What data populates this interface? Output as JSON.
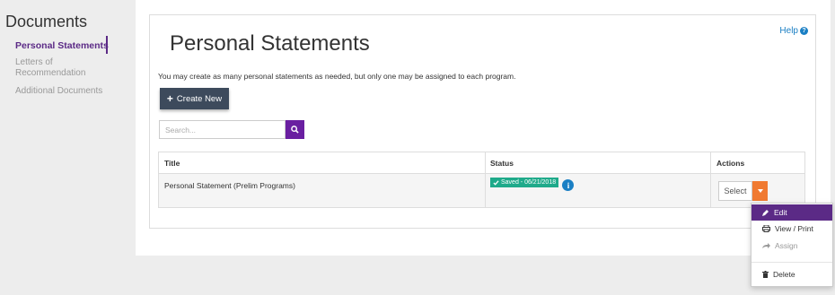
{
  "sidebar": {
    "heading": "Documents",
    "items": [
      {
        "label": "Personal Statements"
      },
      {
        "label": "Letters of"
      },
      {
        "label": "Recommendation"
      },
      {
        "label": "Additional Documents"
      }
    ]
  },
  "main": {
    "title": "Personal Statements",
    "help_label": "Help",
    "intro": "You may create as many personal statements as needed, but only one may be assigned to each program.",
    "create_label": "Create New",
    "search_placeholder": "Search..."
  },
  "table": {
    "headers": {
      "title": "Title",
      "status": "Status",
      "actions": "Actions"
    },
    "rows": [
      {
        "title": "Personal Statement (Prelim Programs)",
        "status": "Saved - 06/21/2018",
        "action_label": "Select"
      }
    ]
  },
  "dropdown": {
    "items": [
      {
        "label": "Edit"
      },
      {
        "label": "View / Print"
      },
      {
        "label": "Assign"
      },
      {
        "label": "Delete"
      }
    ]
  },
  "colors": {
    "accent_purple": "#5b2a86",
    "search_purple": "#6a1fa1",
    "create_button": "#3d4a5c",
    "status_green": "#1faa8a",
    "caret_orange": "#f07a32",
    "link_blue": "#1a7fc4"
  },
  "icons": {
    "help": "question-circle-icon",
    "create": "plus-icon",
    "search": "search-icon",
    "status": "check-icon",
    "info": "info-icon",
    "caret": "caret-down-icon",
    "edit": "pencil-icon",
    "view": "print-icon",
    "assign": "share-icon",
    "delete": "trash-icon"
  }
}
